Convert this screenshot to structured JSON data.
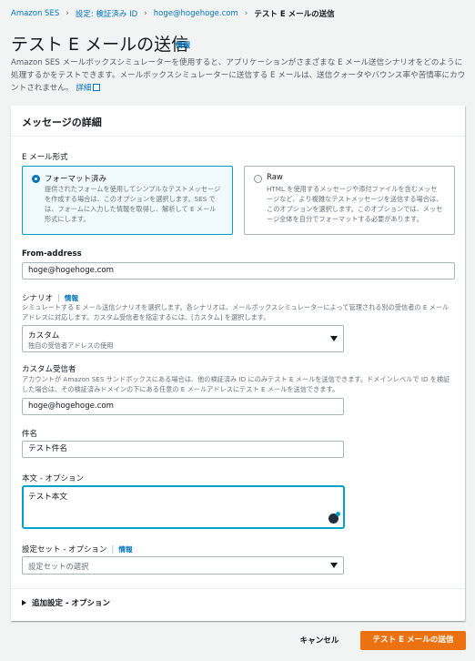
{
  "breadcrumb": [
    "Amazon SES",
    "設定: 検証済み ID",
    "hoge@hogehoge.com",
    "テスト E メールの送信"
  ],
  "page": {
    "title": "テスト E メールの送信",
    "info": "情報",
    "description": "Amazon SES メールボックスシミュレーターを使用すると、アプリケーションがさまざまな E メール送信シナリオをどのように処理するかをテストできます。メールボックスシミュレーターに送信する E メールは、送信クォータやバウンス率や苦情率にカウントされません。",
    "more_link": "詳細"
  },
  "card": {
    "title": "メッセージの詳細",
    "format": {
      "label": "E メール形式",
      "options": [
        {
          "title": "フォーマット済み",
          "desc": "提供されたフォームを使用してシンプルなテストメッセージを作成する場合は、このオプションを選択します。SES では、フォームに入力した情報を取得し、解析して E メール形式にします。",
          "selected": true
        },
        {
          "title": "Raw",
          "desc": "HTML を使用するメッセージや添付ファイルを含むメッセージなど、より複雑なテストメッセージを送信する場合は、このオプションを選択します。このオプションでは、メッセージ全体を自分でフォーマットする必要があります。",
          "selected": false
        }
      ]
    },
    "from": {
      "label": "From-address",
      "value": "hoge@hogehoge.com"
    },
    "scenario": {
      "label": "シナリオ",
      "info": "情報",
      "desc": "シミュレートする E メール送信シナリオを選択します。各シナリオは、メールボックスシミュレーターによって管理される別の受信者の E メールアドレスに対応します。カスタム受信者を指定するには、[カスタム] を選択します。",
      "selected": "カスタム",
      "selected_desc": "独自の受信者アドレスの使用"
    },
    "recipient": {
      "label": "カスタム受信者",
      "desc": "アカウントが Amazon SES サンドボックスにある場合は、他の検証済み ID にのみテスト E メールを送信できます。ドメインレベルで ID を検証した場合は、その検証済みドメインの下にある任意の E メールアドレスにテスト E メールを送信できます。",
      "value": "hoge@hogehoge.com"
    },
    "subject": {
      "label": "件名",
      "value": "テスト件名"
    },
    "body": {
      "label": "本文 - オプション",
      "value": "テスト本文"
    },
    "config_set": {
      "label": "設定セット - オプション",
      "info": "情報",
      "placeholder": "設定セットの選択"
    },
    "advanced": "追加設定 - オプション"
  },
  "actions": {
    "cancel": "キャンセル",
    "send": "テスト E メールの送信"
  }
}
